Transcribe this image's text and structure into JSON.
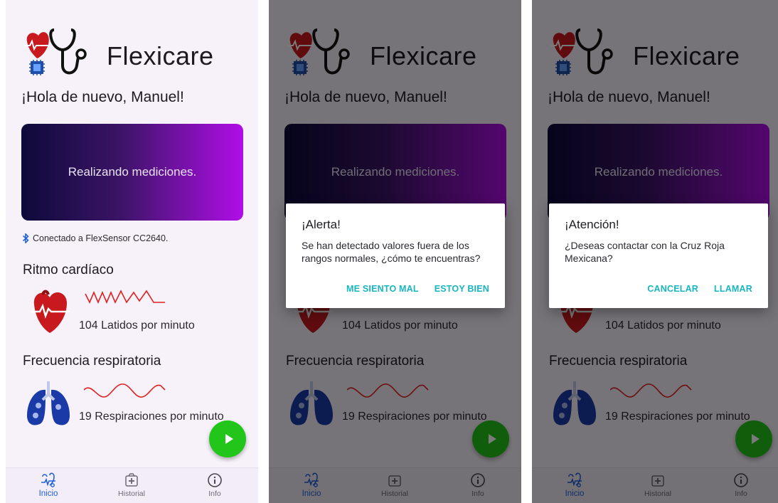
{
  "app": {
    "title": "Flexicare",
    "greeting": "¡Hola de nuevo, Manuel!",
    "status_card": "Realizando mediciones.",
    "bluetooth_status": "Conectado a FlexSensor CC2640."
  },
  "heart_rate": {
    "title": "Ritmo cardíaco",
    "value_text": "104 Latidos por minuto"
  },
  "respiratory": {
    "title": "Frecuencia respiratoria",
    "value_text": "19 Respiraciones por minuto"
  },
  "nav": {
    "inicio": "Inicio",
    "historial": "Historial",
    "info": "Info"
  },
  "dialogs": {
    "alert": {
      "title": "¡Alerta!",
      "message": "Se han detectado valores fuera de los rangos normales, ¿cómo te encuentras?",
      "button_bad": "ME SIENTO MAL",
      "button_ok": "ESTOY BIEN"
    },
    "attention": {
      "title": "¡Atención!",
      "message": "¿Deseas contactar con la Cruz Roja Mexicana?",
      "button_cancel": "CANCELAR",
      "button_call": "LLAMAR"
    }
  },
  "colors": {
    "accent": "#2060d8",
    "fab": "#22c51a",
    "dialog_button": "#18b6c0",
    "wave": "#e0201e"
  },
  "icons": [
    "logo-heart-stethoscope-chip-icon",
    "bluetooth-icon",
    "heart-icon",
    "lungs-icon",
    "play-icon",
    "health-monitor-icon",
    "medical-history-icon",
    "info-icon"
  ]
}
